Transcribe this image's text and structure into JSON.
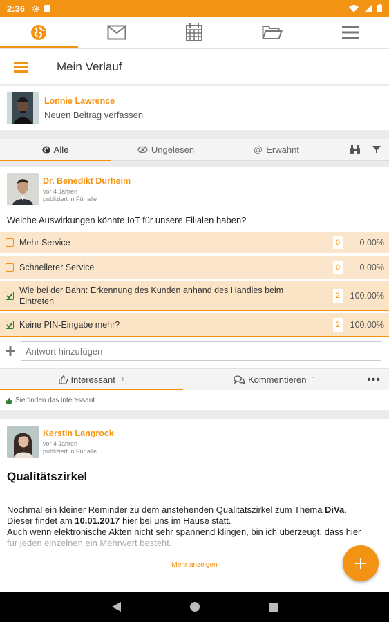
{
  "status": {
    "time": "2:36"
  },
  "topnav": {
    "tabs": [
      {
        "icon": "globe-icon"
      },
      {
        "icon": "mail-icon"
      },
      {
        "icon": "calendar-icon"
      },
      {
        "icon": "folder-icon"
      },
      {
        "icon": "menu-icon"
      }
    ]
  },
  "header": {
    "title": "Mein Verlauf"
  },
  "composer": {
    "user": "Lonnie Lawrence",
    "hint": "Neuen Beitrag verfassen"
  },
  "filters": {
    "all": "Alle",
    "unread": "Ungelesen",
    "mentioned": "Erwähnt"
  },
  "post1": {
    "author": "Dr. Benedikt Durheim",
    "age": "vor 4 Jahren",
    "published": "publiziert in Für alle",
    "question": "Welche Auswirkungen könnte IoT für unsere Filialen haben?",
    "options": [
      {
        "label": "Mehr Service",
        "count": "0",
        "percent": "0.00%",
        "checked": false
      },
      {
        "label": "Schnellerer Service",
        "count": "0",
        "percent": "0.00%",
        "checked": false
      },
      {
        "label": "Wie bei der Bahn: Erkennung des Kunden anhand des Handies beim Eintreten",
        "count": "2",
        "percent": "100.00%",
        "checked": true
      },
      {
        "label": "Keine PIN-Eingabe mehr?",
        "count": "2",
        "percent": "100.00%",
        "checked": true
      }
    ],
    "answer_placeholder": "Antwort hinzufügen",
    "like_label": "Interessant",
    "like_count": "1",
    "comment_label": "Kommentieren",
    "comment_count": "1",
    "liked_text": "Sie finden das interessant"
  },
  "post2": {
    "author": "Kerstin Langrock",
    "age": "vor 4 Jahren",
    "published": "publiziert in Für alle",
    "title": "Qualitätszirkel",
    "line1_a": "Nochmal ein kleiner Reminder zu dem anstehenden Qualitätszirkel zum Thema ",
    "line1_b": "DiVa",
    "line1_c": ".",
    "line2_a": "Dieser findet am ",
    "line2_b": "10.01.2017",
    "line2_c": " hier bei uns im Hause statt.",
    "line3": "Auch wenn elektronische Akten nicht sehr spannend klingen, bin ich überzeugt, dass hier",
    "line4": "für jeden einzelnen ein Mehrwert besteht.",
    "more": "Mehr anzeigen"
  },
  "colors": {
    "accent": "#f39314",
    "poll_bg": "#fbe6cc",
    "check_green": "#2e7d32"
  }
}
